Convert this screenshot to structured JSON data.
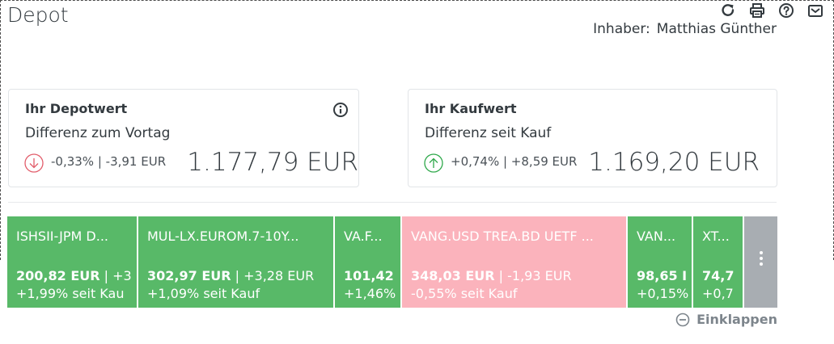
{
  "header": {
    "title": "Depot",
    "owner_label": "Inhaber:",
    "owner_name": "Matthias Günther",
    "icons": [
      "refresh-icon",
      "print-icon",
      "help-icon",
      "mail-icon"
    ]
  },
  "depot_card": {
    "title": "Ihr Depotwert",
    "subtitle": "Differenz zum Vortag",
    "change": "-0,33% | -3,91 EUR",
    "direction": "down",
    "amount": "1.177,79 EUR"
  },
  "purchase_card": {
    "title": "Ihr Kaufwert",
    "subtitle": "Differenz seit Kauf",
    "change": "+0,74% | +8,59 EUR",
    "direction": "up",
    "amount": "1.169,20 EUR"
  },
  "colors": {
    "positive": "#58b968",
    "negative": "#fbb3bc",
    "up_icon": "#2ea84a",
    "down_icon": "#e25d6b",
    "more": "#a8adb2"
  },
  "treemap": {
    "tiles": [
      {
        "name": "ISHSII-JPM D...",
        "value": "200,82 EUR",
        "change": "| +3",
        "pct": "+1,99% seit Kau",
        "status": "positive"
      },
      {
        "name": "MUL-LX.EUROM.7-10Y...",
        "value": "302,97 EUR",
        "change": "| +3,28 EUR",
        "pct": "+1,09% seit Kauf",
        "status": "positive"
      },
      {
        "name": "VA.F...",
        "value": "101,42",
        "change": "",
        "pct": "+1,46%",
        "status": "positive"
      },
      {
        "name": "VANG.USD TREA.BD UETF ...",
        "value": "348,03 EUR",
        "change": "| -1,93 EUR",
        "pct": "-0,55% seit Kauf",
        "status": "negative"
      },
      {
        "name": "VAN...",
        "value": "98,65 I",
        "change": "",
        "pct": "+0,15%",
        "status": "positive"
      },
      {
        "name": "XT...",
        "value": "74,7",
        "change": "",
        "pct": "+0,7",
        "status": "positive"
      }
    ],
    "more_icon": "more-vertical-icon",
    "collapse_label": "Einklappen"
  }
}
